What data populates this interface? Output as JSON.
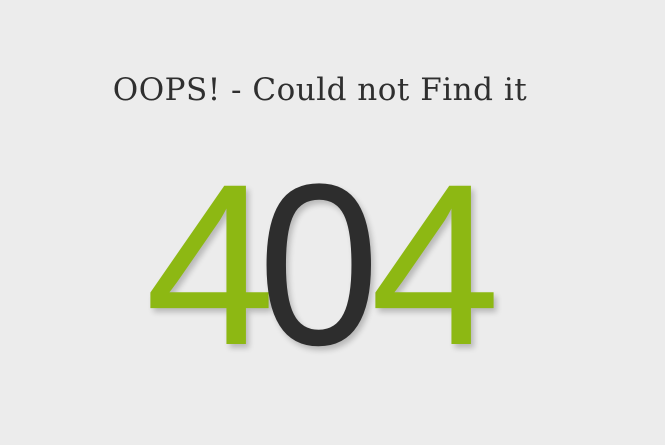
{
  "page": {
    "headline": "OOPS! - Could not Find it",
    "error_code": {
      "digit_1": "4",
      "digit_2": "0",
      "digit_3": "4"
    }
  },
  "colors": {
    "background": "#ececec",
    "accent_green": "#8db813",
    "dark_digit": "#2d2d2d",
    "headline_text": "#2f2f2f"
  }
}
